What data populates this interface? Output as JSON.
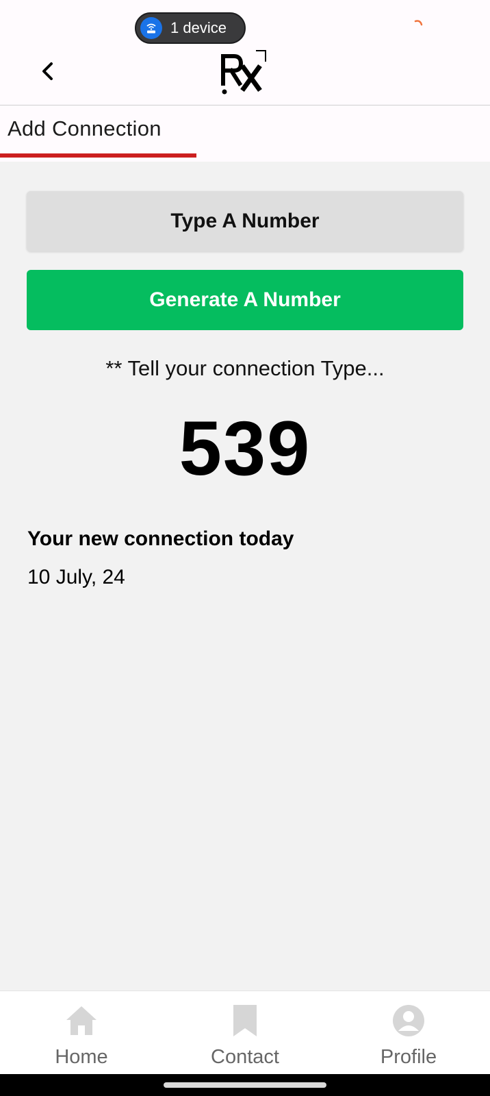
{
  "status_bar": {
    "device_pill": {
      "label": "1 device",
      "icon": "wifi-router-icon"
    }
  },
  "header": {
    "back_icon": "chevron-left-icon",
    "logo_text": "RX"
  },
  "tabs": [
    {
      "label": "Add Connection",
      "active": true
    }
  ],
  "main": {
    "type_button_label": "Type A Number",
    "generate_button_label": "Generate A Number",
    "hint": "** Tell your connection Type...",
    "number": "539",
    "connection_title": "Your new connection today",
    "connection_date": "10 July, 24"
  },
  "bottom_nav": {
    "items": [
      {
        "label": "Home",
        "icon": "home-icon"
      },
      {
        "label": "Contact",
        "icon": "bookmark-icon"
      },
      {
        "label": "Profile",
        "icon": "user-avatar-icon"
      }
    ]
  },
  "colors": {
    "accent_red": "#cc1f1f",
    "generate_green": "#05bd5f",
    "pill_blue": "#1a73e8"
  }
}
